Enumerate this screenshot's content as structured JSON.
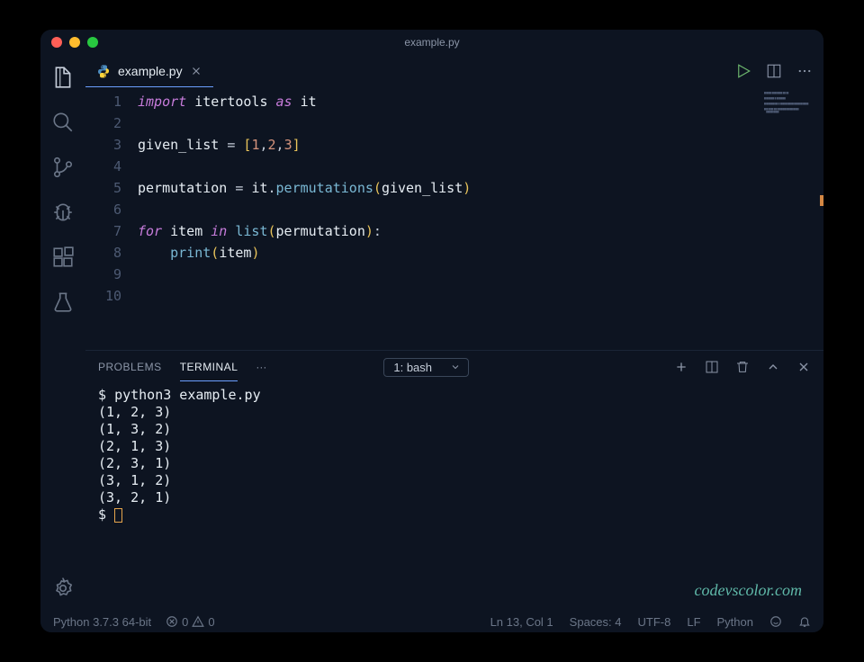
{
  "window": {
    "title": "example.py"
  },
  "tab": {
    "filename": "example.py"
  },
  "code": {
    "lines": [
      {
        "n": "1"
      },
      {
        "n": "2"
      },
      {
        "n": "3"
      },
      {
        "n": "4"
      },
      {
        "n": "5"
      },
      {
        "n": "6"
      },
      {
        "n": "7"
      },
      {
        "n": "8"
      },
      {
        "n": "9"
      },
      {
        "n": "10"
      }
    ],
    "tokens": {
      "l1_import": "import",
      "l1_itertools": "itertools",
      "l1_as": "as",
      "l1_it": "it",
      "l3_var": "given_list",
      "l3_eq": " = ",
      "l3_lb": "[",
      "l3_n1": "1",
      "l3_c1": ",",
      "l3_n2": "2",
      "l3_c2": ",",
      "l3_n3": "3",
      "l3_rb": "]",
      "l5_var": "permutation",
      "l5_eq": " = ",
      "l5_it": "it",
      "l5_dot": ".",
      "l5_fn": "permutations",
      "l5_lp": "(",
      "l5_arg": "given_list",
      "l5_rp": ")",
      "l7_for": "for",
      "l7_item": "item",
      "l7_in": "in",
      "l7_list": "list",
      "l7_lp": "(",
      "l7_arg": "permutation",
      "l7_rp": ")",
      "l7_colon": ":",
      "l8_print": "print",
      "l8_lp": "(",
      "l8_arg": "item",
      "l8_rp": ")"
    }
  },
  "panel": {
    "tabs": {
      "problems": "PROBLEMS",
      "terminal": "TERMINAL",
      "dots": "···"
    },
    "select": "1: bash"
  },
  "terminal": {
    "prompt": "$ ",
    "command": "python3 example.py",
    "output": [
      "(1, 2, 3)",
      "(1, 3, 2)",
      "(2, 1, 3)",
      "(2, 3, 1)",
      "(3, 1, 2)",
      "(3, 2, 1)"
    ]
  },
  "watermark": "codevscolor.com",
  "status": {
    "python": "Python 3.7.3 64-bit",
    "errors": "0",
    "warnings": "0",
    "position": "Ln 13, Col 1",
    "spaces": "Spaces: 4",
    "encoding": "UTF-8",
    "eol": "LF",
    "lang": "Python"
  }
}
